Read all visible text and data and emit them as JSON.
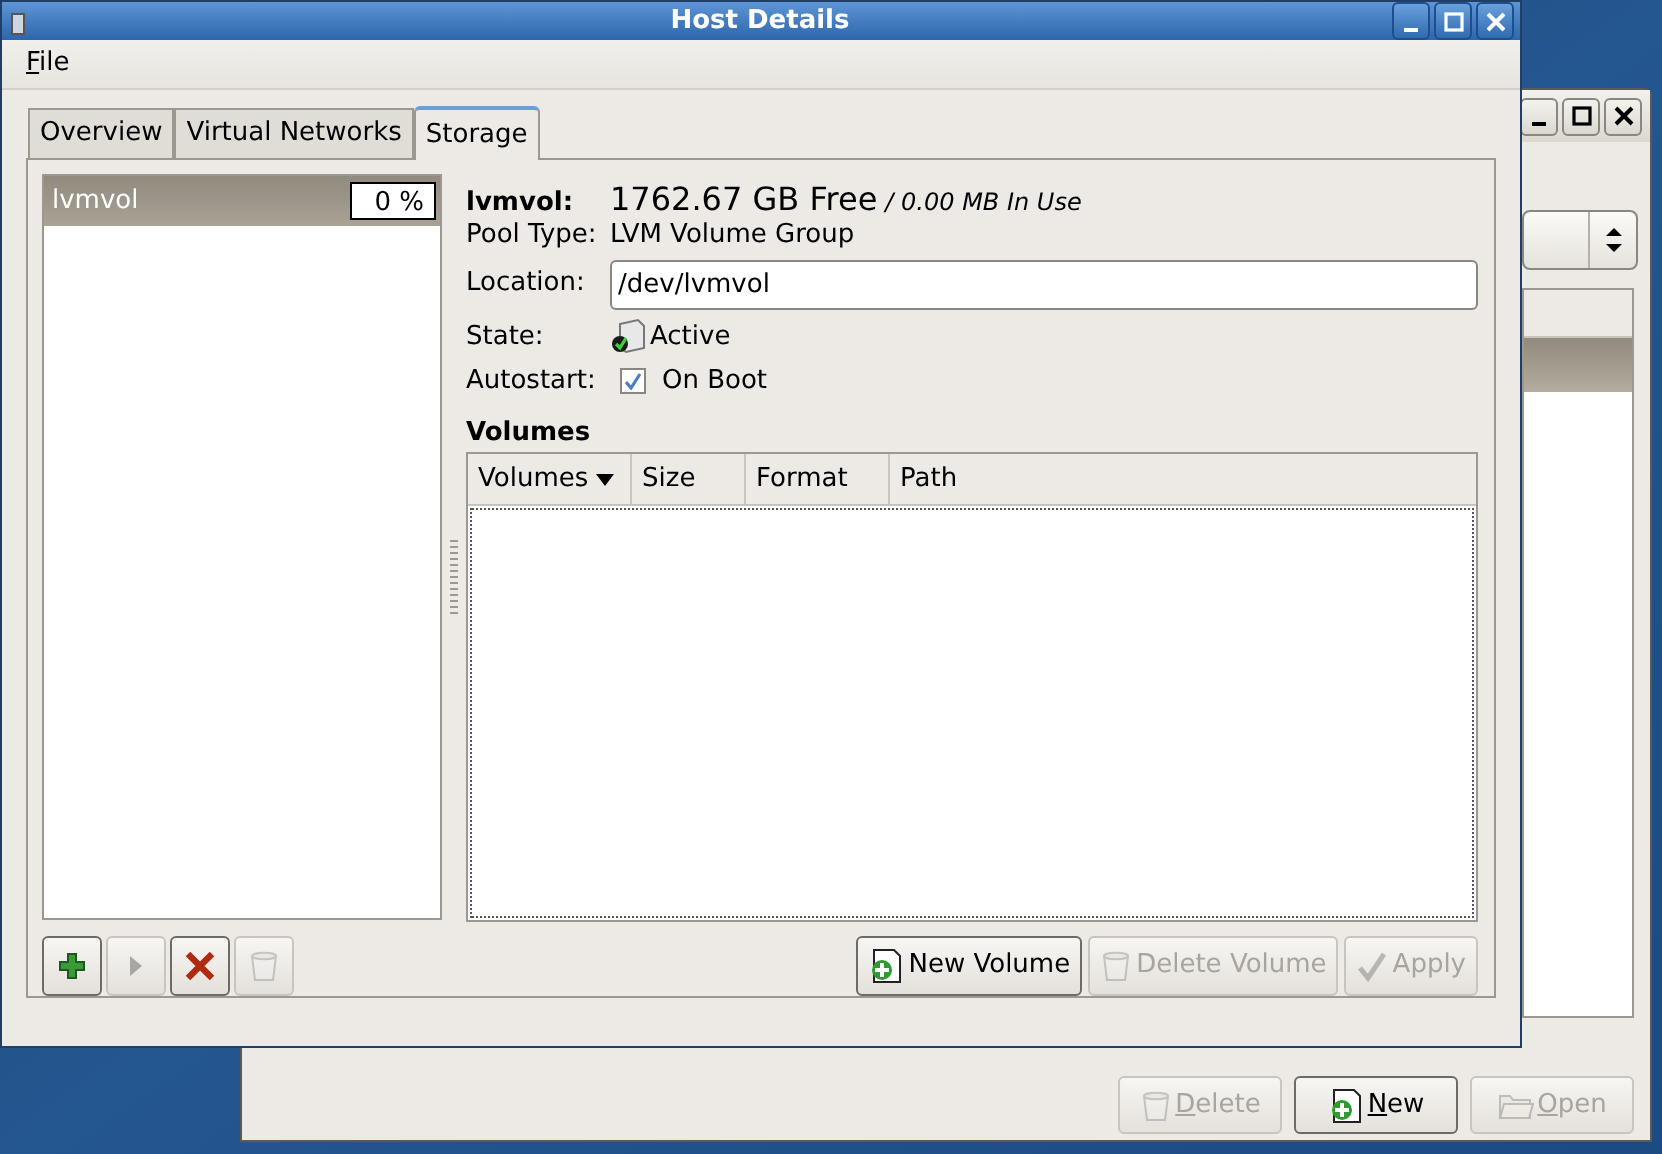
{
  "back_window": {
    "list_rows": [
      {
        "selected": true
      }
    ],
    "buttons": [
      {
        "kind": "trash",
        "label": "Delete",
        "disabled": true
      },
      {
        "kind": "new",
        "label": "New",
        "disabled": false
      },
      {
        "kind": "folder",
        "label": "Open",
        "disabled": true
      }
    ]
  },
  "window": {
    "title": "Host Details",
    "menu": [
      "File"
    ],
    "tabs": [
      {
        "label": "Overview",
        "selected": false
      },
      {
        "label": "Virtual Networks",
        "selected": false
      },
      {
        "label": "Storage",
        "selected": true
      }
    ],
    "pools": [
      {
        "name": "lvmvol",
        "usage": "0 %",
        "selected": true
      }
    ],
    "pool_buttons": [
      {
        "kind": "add",
        "disabled": false
      },
      {
        "kind": "start",
        "disabled": true
      },
      {
        "kind": "stop",
        "disabled": false
      },
      {
        "kind": "trash",
        "disabled": true
      }
    ],
    "details": {
      "name": "lvmvol:",
      "free": "1762.67 GB Free",
      "in_use": "/ 0.00 MB In Use",
      "pool_type_label": "Pool Type:",
      "pool_type": "LVM Volume Group",
      "location_label": "Location:",
      "location": "/dev/lvmvol",
      "state_label": "State:",
      "state": "Active",
      "autostart_label": "Autostart:",
      "autostart_checked": true,
      "autostart_text": "On Boot"
    },
    "volumes": {
      "heading": "Volumes",
      "columns": [
        {
          "label": "Volumes",
          "sorted": true
        },
        {
          "label": "Size",
          "sorted": false
        },
        {
          "label": "Format",
          "sorted": false
        },
        {
          "label": "Path",
          "sorted": false
        }
      ]
    },
    "volume_buttons": [
      {
        "kind": "new",
        "label": "New Volume",
        "disabled": false
      },
      {
        "kind": "trash",
        "label": "Delete Volume",
        "disabled": true
      },
      {
        "kind": "apply",
        "label": "Apply",
        "disabled": true
      }
    ]
  }
}
